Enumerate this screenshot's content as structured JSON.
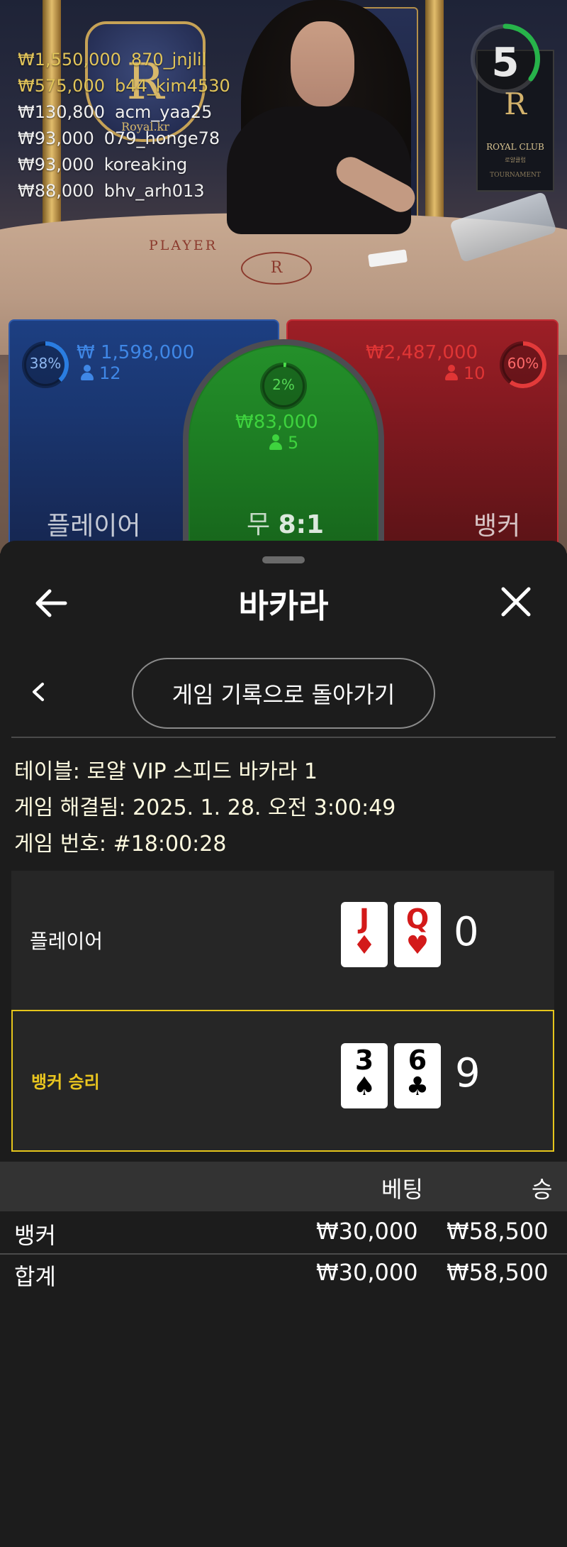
{
  "live": {
    "timer": "5",
    "winners": [
      {
        "amount": "₩1,550,000",
        "user": "870_jnjlil",
        "style": "gold"
      },
      {
        "amount": "₩575,000",
        "user": "b44_kim4530",
        "style": "gold"
      },
      {
        "amount": "₩130,800",
        "user": "acm_yaa25",
        "style": "white"
      },
      {
        "amount": "₩93,000",
        "user": "079_honge78",
        "style": "white"
      },
      {
        "amount": "₩93,000",
        "user": "koreaking",
        "style": "white"
      },
      {
        "amount": "₩88,000",
        "user": "bhv_arh013",
        "style": "white"
      }
    ],
    "player_spot": {
      "percent": "38%",
      "amount": "₩ 1,598,000",
      "players": "12",
      "label": "플레이어"
    },
    "tie_spot": {
      "percent": "2%",
      "amount": "₩83,000",
      "players": "5",
      "label_prefix": "무",
      "odds": "8:1"
    },
    "banker_spot": {
      "percent": "60%",
      "amount": "₩2,487,000",
      "players": "10",
      "label": "뱅커"
    },
    "studio": {
      "crest_letter": "R",
      "crest_text": "Royal.kr",
      "table_label": "PLAYER",
      "sign_club": "ROYAL CLUB",
      "sign_sub": "로얄클럽",
      "sign_tour": "TOURNAMENT"
    }
  },
  "colors": {
    "player": "#2f59a8",
    "banker": "#c42d35",
    "tie": "#1d7a22",
    "win_border": "#e5c51b",
    "timer": "#27b34a"
  },
  "sheet": {
    "title": "바카라",
    "history_button": "게임 기록으로 돌아가기",
    "info": {
      "table": "테이블: 로얄 VIP 스피드 바카라 1",
      "resolved": "게임 해결됨: 2025. 1. 28. 오전 3:00:49",
      "game_number": "게임 번호: #18:00:28"
    },
    "results": [
      {
        "label": "플레이어",
        "cards": [
          {
            "rank": "J",
            "suit": "♦",
            "color": "red"
          },
          {
            "rank": "Q",
            "suit": "♥",
            "color": "red"
          }
        ],
        "score": "0"
      },
      {
        "label": "뱅커 승리",
        "cards": [
          {
            "rank": "3",
            "suit": "♠",
            "color": "black"
          },
          {
            "rank": "6",
            "suit": "♣",
            "color": "black"
          }
        ],
        "score": "9"
      }
    ],
    "table": {
      "headers": {
        "bet": "베팅",
        "win": "승"
      },
      "rows": [
        {
          "name": "뱅커",
          "bet": "₩30,000",
          "win": "₩58,500"
        },
        {
          "name": "합계",
          "bet": "₩30,000",
          "win": "₩58,500"
        }
      ]
    }
  }
}
